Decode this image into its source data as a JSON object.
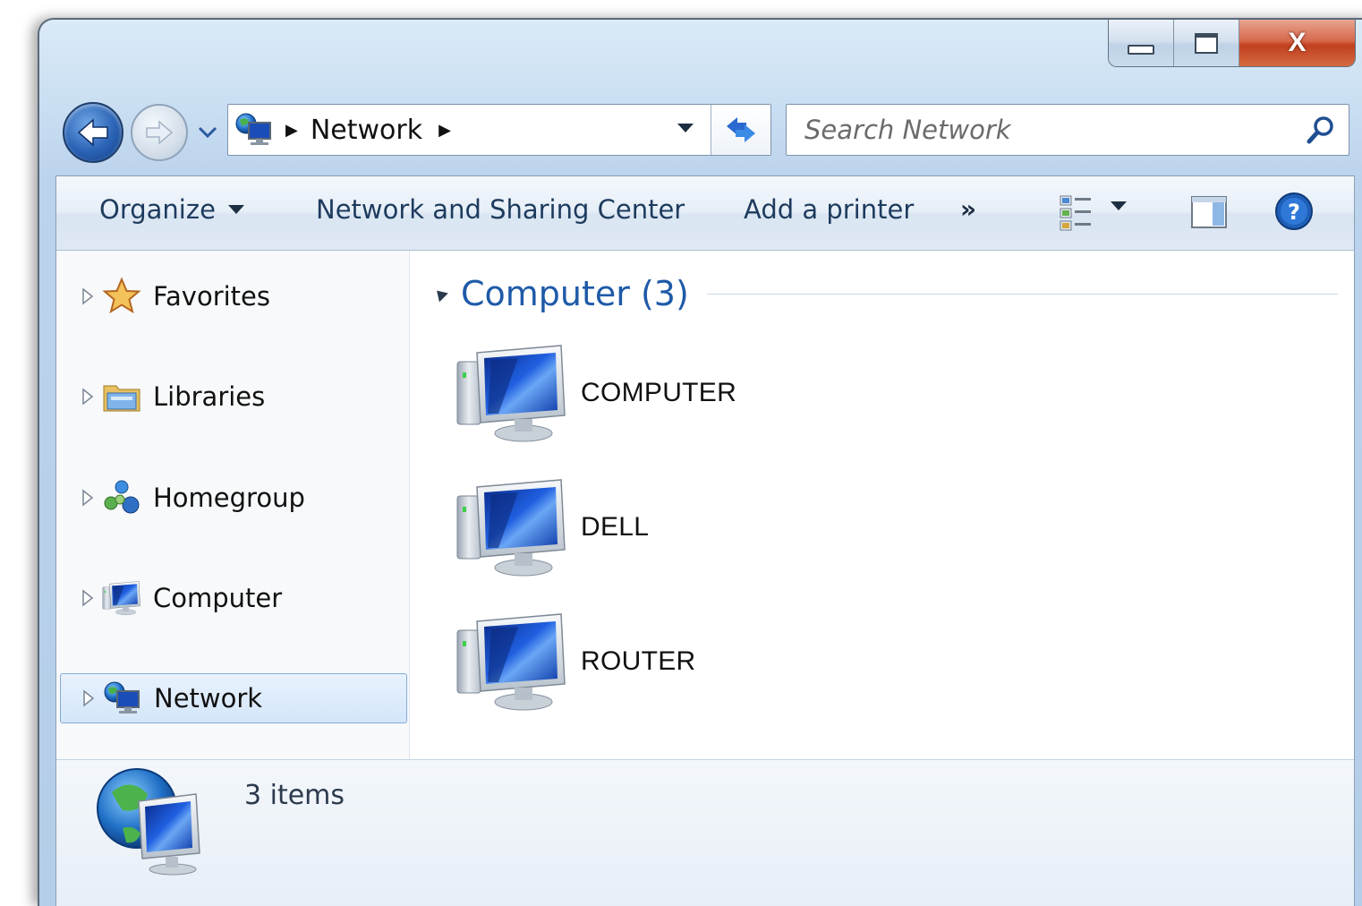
{
  "window": {
    "caption": {
      "minimize_icon": "minimize-icon",
      "maximize_icon": "maximize-icon",
      "close_glyph": "X"
    }
  },
  "navigation": {
    "back_icon": "back-arrow-icon",
    "forward_icon": "forward-arrow-icon",
    "address": {
      "location": "Network",
      "icon": "network-icon"
    },
    "search": {
      "placeholder": "Search Network"
    }
  },
  "commandbar": {
    "organize_label": "Organize",
    "network_sharing_label": "Network and Sharing Center",
    "add_printer_label": "Add a printer",
    "more_label": "»"
  },
  "sidebar": {
    "items": [
      {
        "label": "Favorites",
        "icon": "star-icon"
      },
      {
        "label": "Libraries",
        "icon": "libraries-icon"
      },
      {
        "label": "Homegroup",
        "icon": "homegroup-icon"
      },
      {
        "label": "Computer",
        "icon": "computer-icon"
      },
      {
        "label": "Network",
        "icon": "network-icon",
        "selected": true
      }
    ]
  },
  "content": {
    "group_title": "Computer (3)",
    "items": [
      {
        "label": "COMPUTER",
        "icon": "computer-icon"
      },
      {
        "label": "DELL",
        "icon": "computer-icon"
      },
      {
        "label": "ROUTER",
        "icon": "computer-icon"
      }
    ]
  },
  "details": {
    "count_text": "3 items",
    "icon": "network-globe-icon"
  },
  "colors": {
    "accent_blue": "#1e5aa8",
    "close_red": "#c2401f",
    "selection": "#d3e6fa"
  }
}
